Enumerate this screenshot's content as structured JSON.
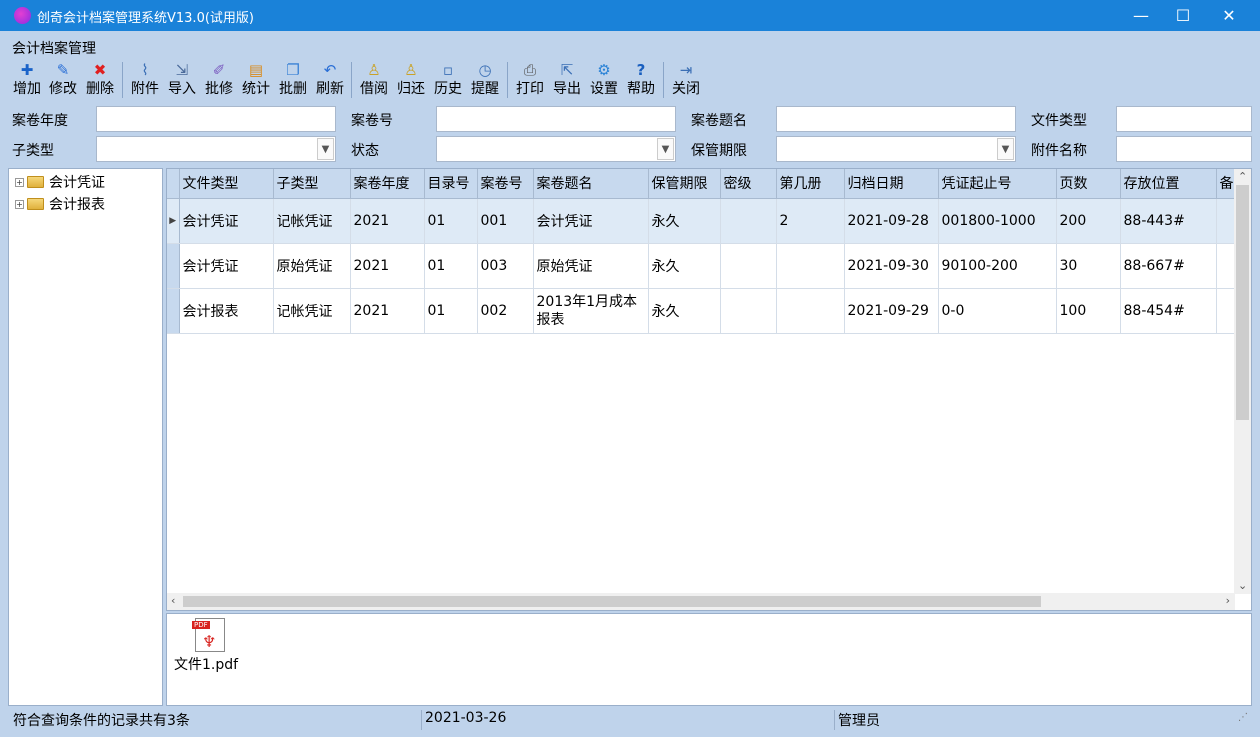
{
  "window": {
    "title": "创奇会计档案管理系统V13.0(试用版)",
    "minimize": "—",
    "maximize": "☐",
    "close": "✕"
  },
  "module_title": "会计档案管理",
  "toolbar": {
    "add": "增加",
    "edit": "修改",
    "delete": "删除",
    "attach": "附件",
    "import": "导入",
    "batch_edit": "批修",
    "stats": "统计",
    "batch_delete": "批删",
    "refresh": "刷新",
    "borrow": "借阅",
    "return": "归还",
    "history": "历史",
    "remind": "提醒",
    "print": "打印",
    "export": "导出",
    "settings": "设置",
    "help": "帮助",
    "close": "关闭"
  },
  "filters": {
    "year_label": "案卷年度",
    "volume_no_label": "案卷号",
    "volume_title_label": "案卷题名",
    "doc_type_label": "文件类型",
    "subtype_label": "子类型",
    "status_label": "状态",
    "retention_label": "保管期限",
    "attachment_name_label": "附件名称"
  },
  "tree": [
    {
      "label": "会计凭证"
    },
    {
      "label": "会计报表"
    }
  ],
  "table": {
    "columns": [
      "文件类型",
      "子类型",
      "案卷年度",
      "目录号",
      "案卷号",
      "案卷题名",
      "保管期限",
      "密级",
      "第几册",
      "归档日期",
      "凭证起止号",
      "页数",
      "存放位置",
      "备"
    ],
    "rows": [
      [
        "会计凭证",
        "记帐凭证",
        "2021",
        "01",
        "001",
        "会计凭证",
        "永久",
        "",
        "2",
        "2021-09-28",
        "001800-1000",
        "200",
        "88-443#",
        ""
      ],
      [
        "会计凭证",
        "原始凭证",
        "2021",
        "01",
        "003",
        "原始凭证",
        "永久",
        "",
        "",
        "2021-09-30",
        "90100-200",
        "30",
        "88-667#",
        ""
      ],
      [
        "会计报表",
        "记帐凭证",
        "2021",
        "01",
        "002",
        "2013年1月成本报表",
        "永久",
        "",
        "",
        "2021-09-29",
        "0-0",
        "100",
        "88-454#",
        ""
      ]
    ]
  },
  "attachments": [
    {
      "name": "文件1.pdf"
    }
  ],
  "status": {
    "record_count": "符合查询条件的记录共有3条",
    "date": "2021-03-26",
    "user": "管理员"
  }
}
